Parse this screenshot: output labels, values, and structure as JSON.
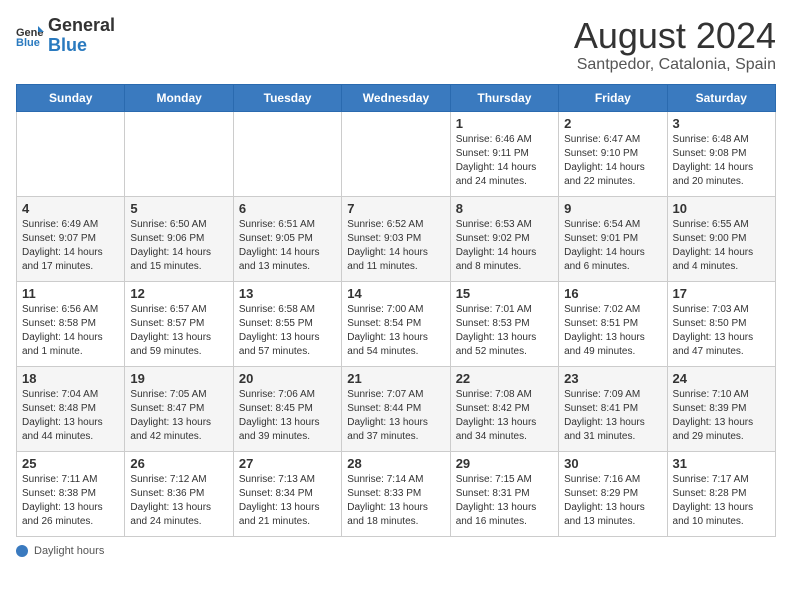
{
  "logo": {
    "general": "General",
    "blue": "Blue"
  },
  "title": "August 2024",
  "subtitle": "Santpedor, Catalonia, Spain",
  "days_of_week": [
    "Sunday",
    "Monday",
    "Tuesday",
    "Wednesday",
    "Thursday",
    "Friday",
    "Saturday"
  ],
  "weeks": [
    [
      {
        "day": "",
        "info": ""
      },
      {
        "day": "",
        "info": ""
      },
      {
        "day": "",
        "info": ""
      },
      {
        "day": "",
        "info": ""
      },
      {
        "day": "1",
        "info": "Sunrise: 6:46 AM\nSunset: 9:11 PM\nDaylight: 14 hours\nand 24 minutes."
      },
      {
        "day": "2",
        "info": "Sunrise: 6:47 AM\nSunset: 9:10 PM\nDaylight: 14 hours\nand 22 minutes."
      },
      {
        "day": "3",
        "info": "Sunrise: 6:48 AM\nSunset: 9:08 PM\nDaylight: 14 hours\nand 20 minutes."
      }
    ],
    [
      {
        "day": "4",
        "info": "Sunrise: 6:49 AM\nSunset: 9:07 PM\nDaylight: 14 hours\nand 17 minutes."
      },
      {
        "day": "5",
        "info": "Sunrise: 6:50 AM\nSunset: 9:06 PM\nDaylight: 14 hours\nand 15 minutes."
      },
      {
        "day": "6",
        "info": "Sunrise: 6:51 AM\nSunset: 9:05 PM\nDaylight: 14 hours\nand 13 minutes."
      },
      {
        "day": "7",
        "info": "Sunrise: 6:52 AM\nSunset: 9:03 PM\nDaylight: 14 hours\nand 11 minutes."
      },
      {
        "day": "8",
        "info": "Sunrise: 6:53 AM\nSunset: 9:02 PM\nDaylight: 14 hours\nand 8 minutes."
      },
      {
        "day": "9",
        "info": "Sunrise: 6:54 AM\nSunset: 9:01 PM\nDaylight: 14 hours\nand 6 minutes."
      },
      {
        "day": "10",
        "info": "Sunrise: 6:55 AM\nSunset: 9:00 PM\nDaylight: 14 hours\nand 4 minutes."
      }
    ],
    [
      {
        "day": "11",
        "info": "Sunrise: 6:56 AM\nSunset: 8:58 PM\nDaylight: 14 hours\nand 1 minute."
      },
      {
        "day": "12",
        "info": "Sunrise: 6:57 AM\nSunset: 8:57 PM\nDaylight: 13 hours\nand 59 minutes."
      },
      {
        "day": "13",
        "info": "Sunrise: 6:58 AM\nSunset: 8:55 PM\nDaylight: 13 hours\nand 57 minutes."
      },
      {
        "day": "14",
        "info": "Sunrise: 7:00 AM\nSunset: 8:54 PM\nDaylight: 13 hours\nand 54 minutes."
      },
      {
        "day": "15",
        "info": "Sunrise: 7:01 AM\nSunset: 8:53 PM\nDaylight: 13 hours\nand 52 minutes."
      },
      {
        "day": "16",
        "info": "Sunrise: 7:02 AM\nSunset: 8:51 PM\nDaylight: 13 hours\nand 49 minutes."
      },
      {
        "day": "17",
        "info": "Sunrise: 7:03 AM\nSunset: 8:50 PM\nDaylight: 13 hours\nand 47 minutes."
      }
    ],
    [
      {
        "day": "18",
        "info": "Sunrise: 7:04 AM\nSunset: 8:48 PM\nDaylight: 13 hours\nand 44 minutes."
      },
      {
        "day": "19",
        "info": "Sunrise: 7:05 AM\nSunset: 8:47 PM\nDaylight: 13 hours\nand 42 minutes."
      },
      {
        "day": "20",
        "info": "Sunrise: 7:06 AM\nSunset: 8:45 PM\nDaylight: 13 hours\nand 39 minutes."
      },
      {
        "day": "21",
        "info": "Sunrise: 7:07 AM\nSunset: 8:44 PM\nDaylight: 13 hours\nand 37 minutes."
      },
      {
        "day": "22",
        "info": "Sunrise: 7:08 AM\nSunset: 8:42 PM\nDaylight: 13 hours\nand 34 minutes."
      },
      {
        "day": "23",
        "info": "Sunrise: 7:09 AM\nSunset: 8:41 PM\nDaylight: 13 hours\nand 31 minutes."
      },
      {
        "day": "24",
        "info": "Sunrise: 7:10 AM\nSunset: 8:39 PM\nDaylight: 13 hours\nand 29 minutes."
      }
    ],
    [
      {
        "day": "25",
        "info": "Sunrise: 7:11 AM\nSunset: 8:38 PM\nDaylight: 13 hours\nand 26 minutes."
      },
      {
        "day": "26",
        "info": "Sunrise: 7:12 AM\nSunset: 8:36 PM\nDaylight: 13 hours\nand 24 minutes."
      },
      {
        "day": "27",
        "info": "Sunrise: 7:13 AM\nSunset: 8:34 PM\nDaylight: 13 hours\nand 21 minutes."
      },
      {
        "day": "28",
        "info": "Sunrise: 7:14 AM\nSunset: 8:33 PM\nDaylight: 13 hours\nand 18 minutes."
      },
      {
        "day": "29",
        "info": "Sunrise: 7:15 AM\nSunset: 8:31 PM\nDaylight: 13 hours\nand 16 minutes."
      },
      {
        "day": "30",
        "info": "Sunrise: 7:16 AM\nSunset: 8:29 PM\nDaylight: 13 hours\nand 13 minutes."
      },
      {
        "day": "31",
        "info": "Sunrise: 7:17 AM\nSunset: 8:28 PM\nDaylight: 13 hours\nand 10 minutes."
      }
    ]
  ],
  "footer": {
    "label": "Daylight hours"
  },
  "colors": {
    "header_bg": "#3a7abf",
    "accent": "#2a7abf"
  }
}
